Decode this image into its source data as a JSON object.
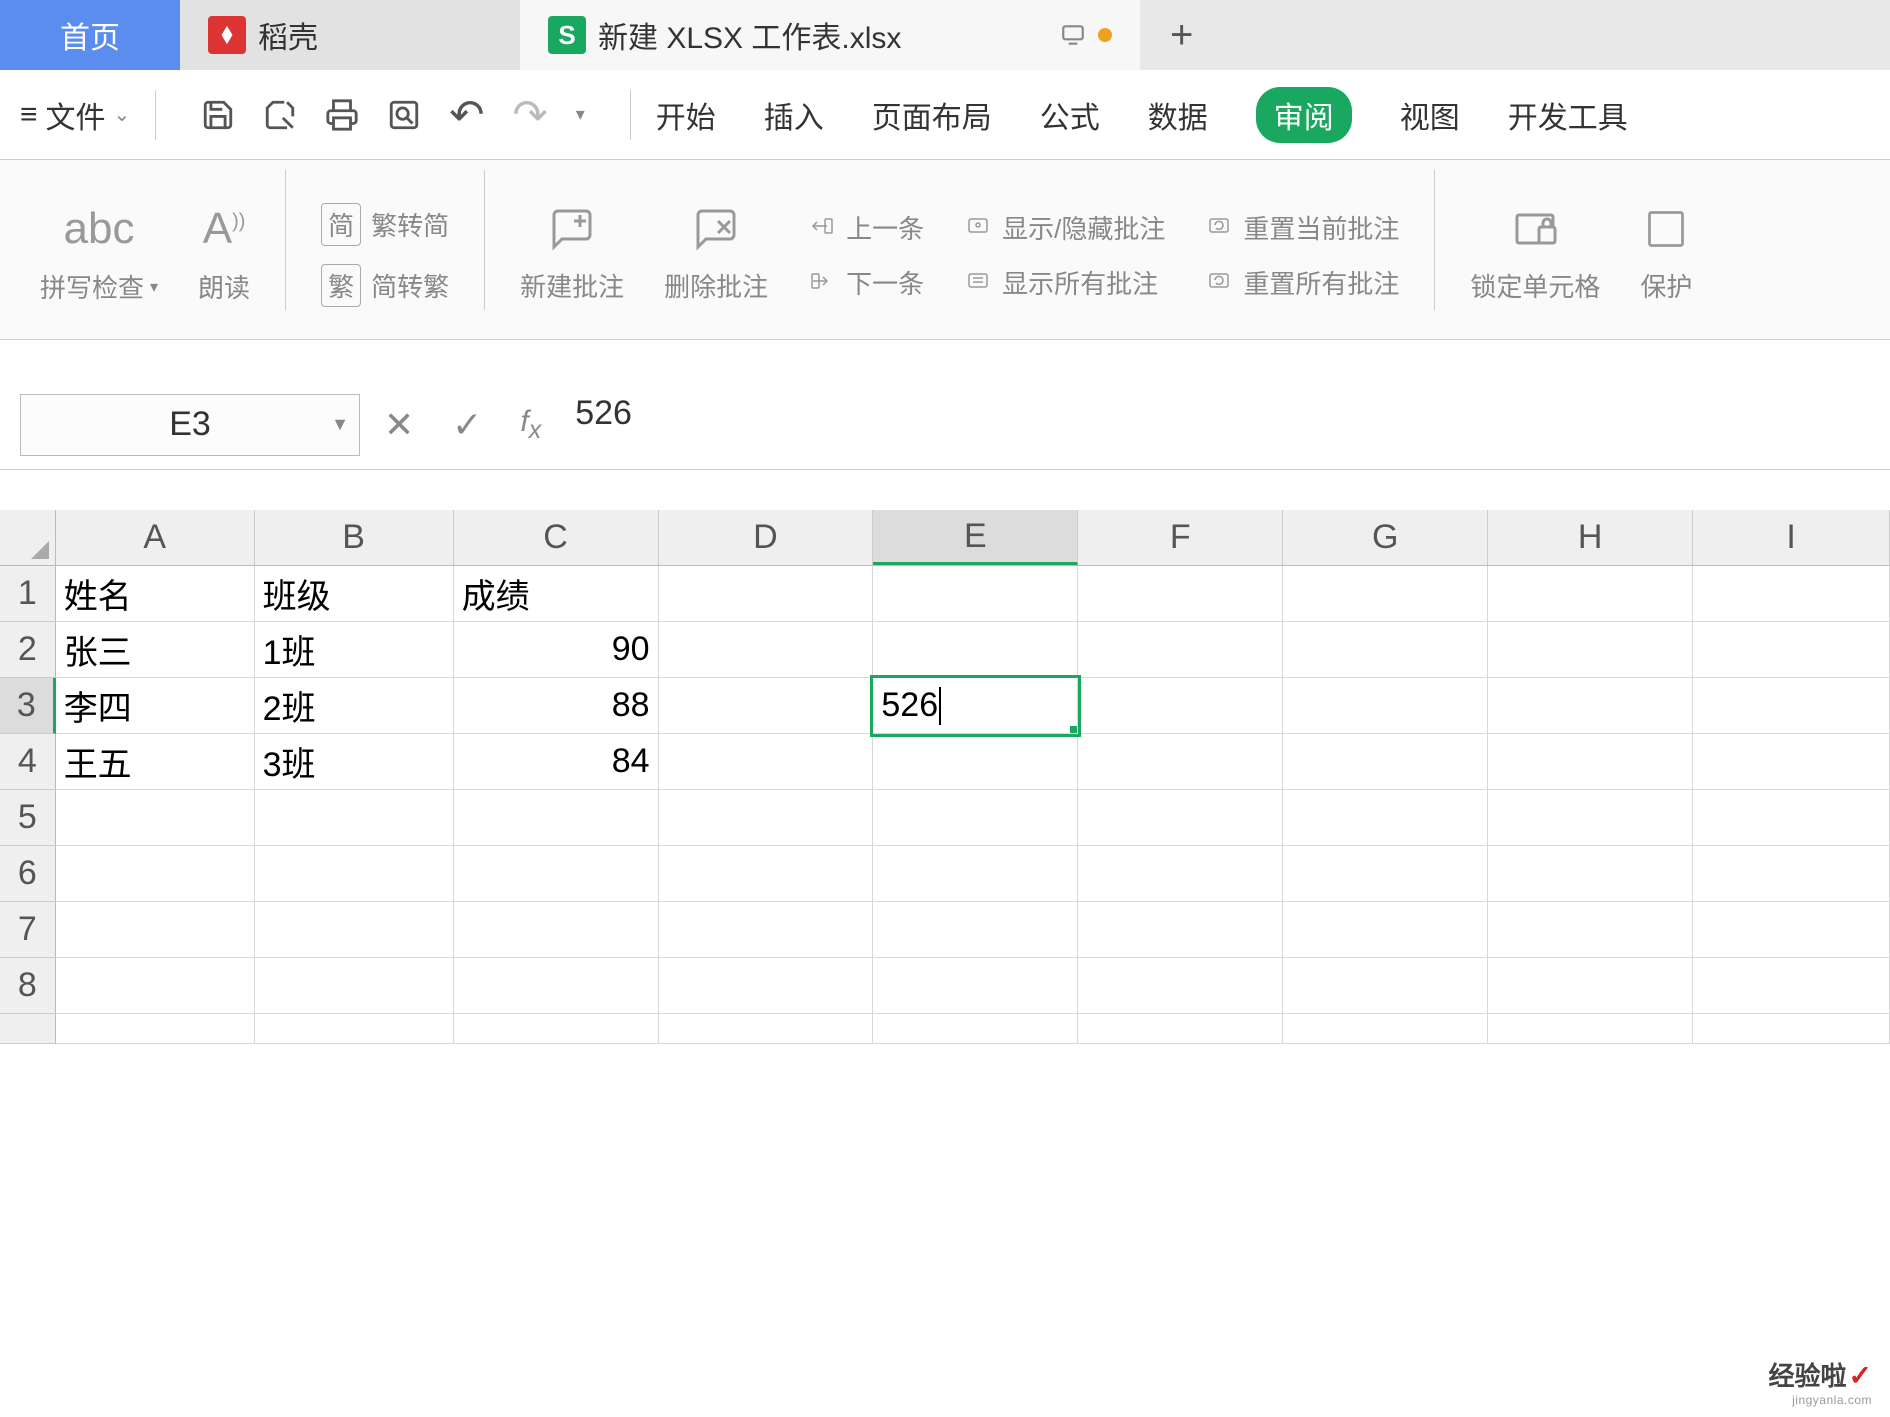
{
  "tabs": {
    "home": "首页",
    "dao": "稻壳",
    "xlsx": "新建 XLSX 工作表.xlsx"
  },
  "file_menu": "文件",
  "menu": {
    "start": "开始",
    "insert": "插入",
    "layout": "页面布局",
    "formula": "公式",
    "data": "数据",
    "review": "审阅",
    "view": "视图",
    "dev": "开发工具"
  },
  "ribbon": {
    "spellcheck_icon": "abc",
    "spellcheck": "拼写检查",
    "read": "朗读",
    "t2s_top": "繁转简",
    "t2s_bot": "简转繁",
    "t2s_jian": "简",
    "t2s_fan": "繁",
    "new_comment": "新建批注",
    "del_comment": "删除批注",
    "prev": "上一条",
    "next": "下一条",
    "show_hide": "显示/隐藏批注",
    "show_all": "显示所有批注",
    "reset_cur": "重置当前批注",
    "reset_all": "重置所有批注",
    "lock_cell": "锁定单元格",
    "protect": "保护"
  },
  "formula_bar": {
    "cell_ref": "E3",
    "value": "526"
  },
  "columns": [
    "A",
    "B",
    "C",
    "D",
    "E",
    "F",
    "G",
    "H",
    "I"
  ],
  "rows_shown": 8,
  "selected": {
    "col": "E",
    "row": 3
  },
  "data_rows": [
    {
      "A": "姓名",
      "B": "班级",
      "C": "成绩",
      "D": "",
      "E": ""
    },
    {
      "A": "张三",
      "B": "1班",
      "C": "90",
      "D": "",
      "E": ""
    },
    {
      "A": "李四",
      "B": "2班",
      "C": "88",
      "D": "",
      "E": "526"
    },
    {
      "A": "王五",
      "B": "3班",
      "C": "84",
      "D": "",
      "E": ""
    },
    {
      "A": "",
      "B": "",
      "C": "",
      "D": "",
      "E": ""
    },
    {
      "A": "",
      "B": "",
      "C": "",
      "D": "",
      "E": ""
    },
    {
      "A": "",
      "B": "",
      "C": "",
      "D": "",
      "E": ""
    },
    {
      "A": "",
      "B": "",
      "C": "",
      "D": "",
      "E": ""
    }
  ],
  "watermark": {
    "cn": "经验啦",
    "check": "✓",
    "domain": "jingyanla.com"
  }
}
